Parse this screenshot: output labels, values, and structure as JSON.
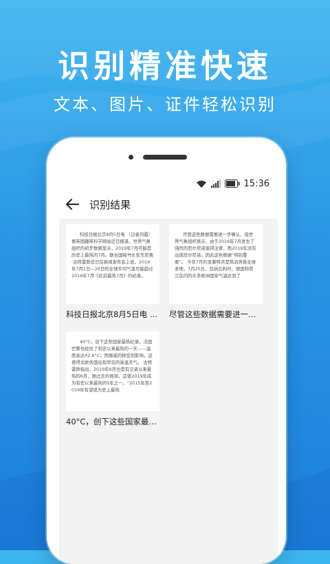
{
  "promo": {
    "headline": "识别精准快速",
    "subline": "文本、图片、证件轻松识别"
  },
  "status_bar": {
    "time": "15:36",
    "icons": [
      "wifi-icon",
      "signal-icon",
      "battery-icon"
    ]
  },
  "app_bar": {
    "back_icon": "arrow-left-icon",
    "title": "识别结果"
  },
  "results": [
    {
      "thumb_text": "科技日报北京8月5日电 （记者刘霞）据英国趣味科学网站近日报道，世界气象组织的初步数据显示，2019年7月可能是历史上最热的7月。联合国秘书长安东尼奥·古特雷斯近日在新闻发布会上说，2019年7月1日—29日的全球平均气温可能超过2016年7月《此前最热7月》的纪录。",
      "caption": "科技日报北京8月5日电 （..."
    },
    {
      "thumb_text": "尽管这些数据需要进一步确认，但世界气象组织表示，由于2016年7月发生了强烈的厄尔尼诺值得注意，而2019年没有出现厄尔尼诺，因此这些数据“特别重要”。 今年7月的显著特点是热浪席卷全球多地，7月25日，包括比利时、德国和荷兰在内的众多欧洲国家气温达到了",
      "caption": "尽管这些数据需要进一步..."
    },
    {
      "thumb_text": "40°C，创下这些国家最热纪录，法国巴黎也经历了有史以来最热的一天——温度高达42.6°C；而挪威同样受到影响，这使得北欧各国出现罕见的高温天气。 古特雷斯指出，2019年6月也是有记录以来最热的6月，据过去的观测，这使2019年成为有史以来最热的5年之一。“2015年至2019年有望成为史上最热",
      "caption": "40°C，创下这些国家最热..."
    }
  ],
  "colors": {
    "background_top": "#3fb6ef",
    "background_bottom": "#1d7fdc",
    "phone_body": "#ffffff",
    "content_bg": "#f3f3f3"
  }
}
